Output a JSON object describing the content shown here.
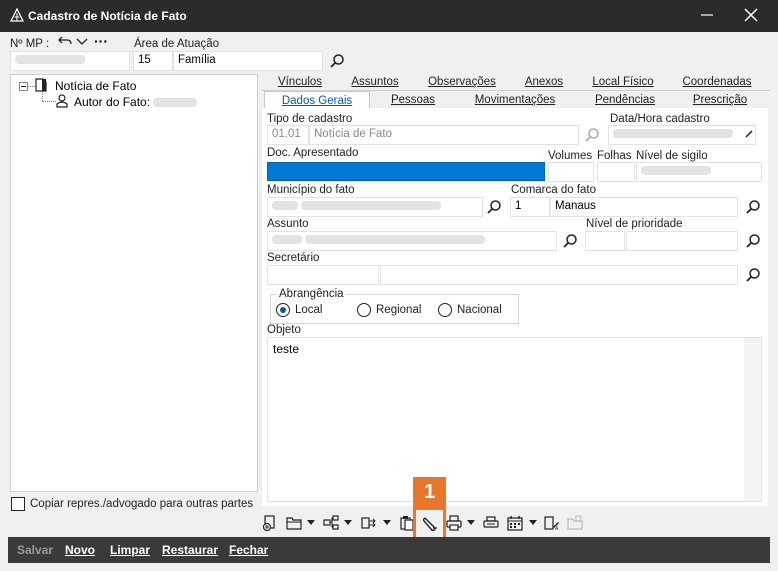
{
  "window": {
    "title": "Cadastro de Notícia de Fato"
  },
  "header": {
    "mp_label": "Nº MP :",
    "area_label": "Área de Atuação",
    "area_code": "15",
    "area_name": "Família"
  },
  "tree": {
    "root": "Notícia de Fato",
    "child_label": "Autor do Fato:"
  },
  "tabs_row1": [
    "Vínculos",
    "Assuntos",
    "Observações",
    "Anexos",
    "Local Físico",
    "Coordenadas"
  ],
  "tabs_row2": [
    "Dados Gerais",
    "Pessoas",
    "Movimentações",
    "Pendências",
    "Prescrição"
  ],
  "form": {
    "tipo_label": "Tipo de cadastro",
    "tipo_code": "01.01",
    "tipo_name": "Notícia de Fato",
    "data_label": "Data/Hora cadastro",
    "doc_label": "Doc. Apresentado",
    "volumes_label": "Volumes",
    "folhas_label": "Folhas",
    "sigilo_label": "Nível de sigilo",
    "municipio_label": "Município do fato",
    "comarca_label": "Comarca do fato",
    "comarca_code": "1",
    "comarca_name": "Manaus",
    "assunto_label": "Assunto",
    "prioridade_label": "Nível de prioridade",
    "secretario_label": "Secretário",
    "abrangencia_label": "Abrangência",
    "abrangencia_options": [
      "Local",
      "Regional",
      "Nacional"
    ],
    "abrangencia_selected": "Local",
    "objeto_label": "Objeto",
    "objeto_value": "teste"
  },
  "copy_checkbox_label": "Copiar repres./advogado para outras partes",
  "annotation_number": "1",
  "bottom_buttons": {
    "salvar": "Salvar",
    "novo": "Novo",
    "limpar": "Limpar",
    "restaurar": "Restaurar",
    "fechar": "Fechar"
  },
  "colors": {
    "accent": "#0a5aa5",
    "highlight": "#e8772e",
    "selection": "#0078d7"
  }
}
